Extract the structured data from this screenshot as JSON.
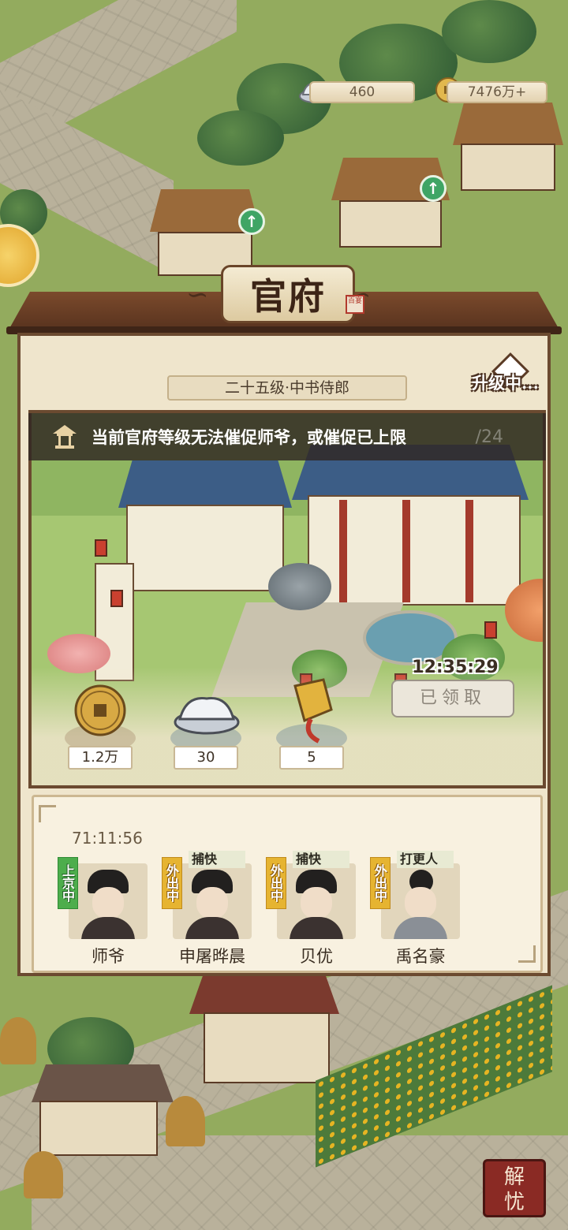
{
  "resources": {
    "silver": "460",
    "coins": "7476万+"
  },
  "dialog": {
    "title": "官府",
    "seal_text": "百宴",
    "rank": "二十五级·中书侍郎",
    "upgrade_status": "升级中...",
    "toast": "当前官府等级无法催促师爷，或催促已上限",
    "toast_tail": "/24",
    "rewards": [
      {
        "icon": "copper-coin-icon",
        "amount": "1.2万"
      },
      {
        "icon": "silver-ingot-icon",
        "amount": "30"
      },
      {
        "icon": "token-icon",
        "amount": "5"
      }
    ],
    "reward_timer": "12:35:29",
    "claimed_label": "已领取",
    "officials_timer": "71:11:56",
    "officials": [
      {
        "name": "师爷",
        "role": "",
        "status": "上京中"
      },
      {
        "name": "申屠晔晨",
        "role": "捕快",
        "status": "外出中"
      },
      {
        "name": "贝优",
        "role": "捕快",
        "status": "外出中"
      },
      {
        "name": "禹名豪",
        "role": "打更人",
        "status": "外出中"
      }
    ]
  },
  "side_button": "解忧",
  "colors": {
    "wood": "#6b4a30",
    "parchment": "#efe5cc",
    "status_out": "#e6b431",
    "status_capital": "#4dad4c"
  }
}
